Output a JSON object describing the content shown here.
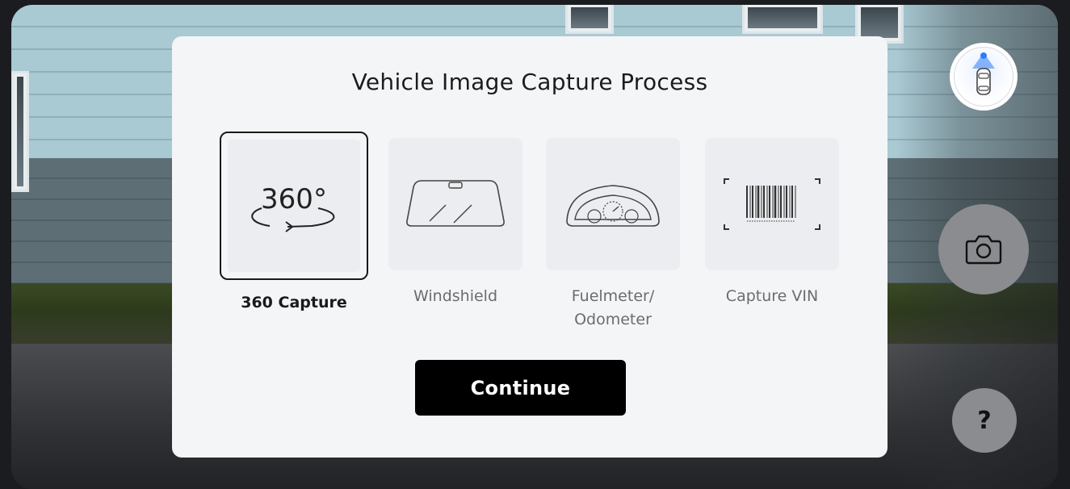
{
  "modal": {
    "title": "Vehicle Image Capture Process",
    "options": [
      {
        "label": "360 Capture",
        "selected": true,
        "icon": "360-rotate-icon",
        "icon_text": "360°"
      },
      {
        "label": "Windshield",
        "selected": false,
        "icon": "windshield-icon"
      },
      {
        "label_line1": "Fuelmeter/",
        "label_line2": "Odometer",
        "selected": false,
        "icon": "dashboard-gauge-icon"
      },
      {
        "label": "Capture VIN",
        "selected": false,
        "icon": "barcode-scan-icon"
      }
    ],
    "continue_label": "Continue"
  },
  "controls": {
    "orientation_icon": "car-orientation-icon",
    "shutter_icon": "camera-icon",
    "help_label": "?"
  },
  "colors": {
    "modal_bg": "#f4f5f7",
    "tile_bg": "#ebedf0",
    "button_bg": "#000000",
    "button_text": "#ffffff",
    "side_button_bg": "#8a8c8f",
    "orientation_accent": "#2f7df6"
  }
}
